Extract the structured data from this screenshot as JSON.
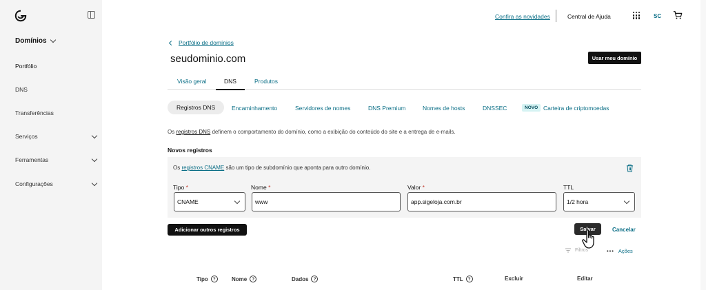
{
  "sidebar": {
    "header": "Domínios",
    "items": [
      {
        "label": "Portfólio"
      },
      {
        "label": "DNS"
      },
      {
        "label": "Transferências"
      },
      {
        "label": "Serviços"
      },
      {
        "label": "Ferramentas"
      },
      {
        "label": "Configurações"
      }
    ]
  },
  "topbar": {
    "news_link": "Confira as novidades",
    "help": "Central de Ajuda",
    "avatar": "SC"
  },
  "page": {
    "back_link": "Portfólio de domínios",
    "domain": "seudominio.com",
    "use_button": "Usar meu domínio",
    "tabs": [
      {
        "label": "Visão geral"
      },
      {
        "label": "DNS"
      },
      {
        "label": "Produtos"
      }
    ],
    "subtabs": [
      {
        "label": "Registros DNS"
      },
      {
        "label": "Encaminhamento"
      },
      {
        "label": "Servidores de nomes"
      },
      {
        "label": "DNS Premium"
      },
      {
        "label": "Nomes de hosts"
      },
      {
        "label": "DNSSEC"
      },
      {
        "label": "Carteira de criptomoedas"
      }
    ],
    "new_badge": "NOVO",
    "desc_prefix": "Os ",
    "desc_link": "registros DNS",
    "desc_suffix": " definem o comportamento do domínio, como a exibição do conteúdo do site e a entrega de e-mails.",
    "section_title": "Novos registros"
  },
  "record": {
    "info_prefix": "Os ",
    "info_link": "registros CNAME",
    "info_suffix": " são um tipo de subdomínio que aponta para outro domínio.",
    "fields": {
      "type_label": "Tipo",
      "type_value": "CNAME",
      "name_label": "Nome",
      "name_value": "www",
      "value_label": "Valor",
      "value_value": "app.sigeloja.com.br",
      "ttl_label": "TTL",
      "ttl_value": "1/2 hora",
      "required_mark": "*"
    }
  },
  "buttons": {
    "add_more": "Adicionar outros registros",
    "save": "Salvar",
    "cancel": "Cancelar"
  },
  "table_tools": {
    "filter": "Filtros",
    "actions": "Ações"
  },
  "table": {
    "headers": [
      "Tipo",
      "Nome",
      "Dados",
      "TTL",
      "Excluir",
      "Editar"
    ]
  },
  "colors": {
    "accent": "#0a6e86",
    "primary_button": "#111111",
    "sidebar_bg": "#f4f4f4"
  }
}
